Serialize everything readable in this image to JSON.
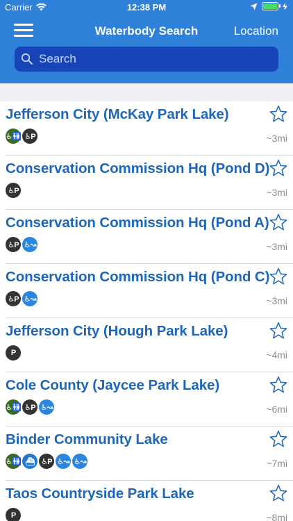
{
  "status": {
    "carrier": "Carrier",
    "time": "12:38 PM"
  },
  "nav": {
    "title": "Waterbody Search",
    "right_button": "Location"
  },
  "search": {
    "placeholder": "Search"
  },
  "lakes": [
    {
      "name": "Jefferson City (McKay Park Lake)",
      "distance": "~3mi",
      "icons": [
        "restroom-accessible-icon",
        "parking-accessible-icon"
      ]
    },
    {
      "name": "Conservation Commission Hq (Pond D)",
      "distance": "~3mi",
      "icons": [
        "parking-accessible-icon"
      ]
    },
    {
      "name": "Conservation Commission Hq (Pond A)",
      "distance": "~3mi",
      "icons": [
        "parking-accessible-icon",
        "fishing-accessible-icon"
      ]
    },
    {
      "name": "Conservation Commission Hq (Pond C)",
      "distance": "~3mi",
      "icons": [
        "parking-accessible-icon",
        "fishing-accessible-icon"
      ]
    },
    {
      "name": "Jefferson City (Hough Park Lake)",
      "distance": "~4mi",
      "icons": [
        "parking-icon"
      ]
    },
    {
      "name": "Cole County (Jaycee Park Lake)",
      "distance": "~6mi",
      "icons": [
        "restroom-accessible-icon",
        "parking-accessible-icon",
        "fishing-accessible-icon"
      ]
    },
    {
      "name": "Binder Community Lake",
      "distance": "~7mi",
      "icons": [
        "restroom-accessible-icon",
        "boat-ramp-icon",
        "parking-accessible-icon",
        "fishing-accessible-icon",
        "fishing-accessible-icon"
      ]
    },
    {
      "name": "Taos Countryside Park Lake",
      "distance": "~8mi",
      "icons": [
        "parking-icon"
      ]
    }
  ],
  "colors": {
    "nav": "#2f80d8",
    "search_bg": "#1745b8",
    "title": "#1e67b8",
    "distance": "#8e8e93"
  }
}
